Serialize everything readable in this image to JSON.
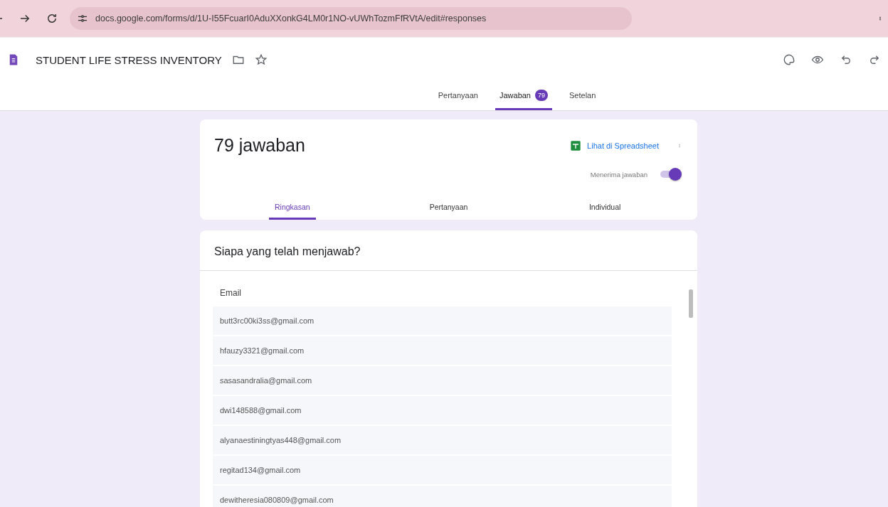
{
  "browser": {
    "url": "docs.google.com/forms/d/1U-I55FcuarI0AduXXonkG4LM0r1NO-vUWhTozmFfRVtA/edit#responses"
  },
  "form": {
    "title": "STUDENT LIFE STRESS INVENTORY"
  },
  "tabs": [
    {
      "label": "Pertanyaan",
      "selected": false
    },
    {
      "label": "Jawaban",
      "selected": true,
      "badge": "79"
    },
    {
      "label": "Setelan",
      "selected": false
    }
  ],
  "summary": {
    "title": "79 jawaban",
    "sheet_link": "Lihat di Spreadsheet",
    "accepting_label": "Menerima jawaban",
    "accepting": true,
    "tabs": [
      {
        "label": "Ringkasan",
        "selected": true
      },
      {
        "label": "Pertanyaan",
        "selected": false
      },
      {
        "label": "Individual",
        "selected": false
      }
    ]
  },
  "respondents": {
    "title": "Siapa yang telah menjawab?",
    "column": "Email",
    "emails": [
      "butt3rc00ki3ss@gmail.com",
      "hfauzy3321@gmail.com",
      "sasasandralia@gmail.com",
      "dwi148588@gmail.com",
      "alyanaestiningtyas448@gmail.com",
      "regitad134@gmail.com",
      "dewitheresia080809@gmail.com"
    ]
  }
}
